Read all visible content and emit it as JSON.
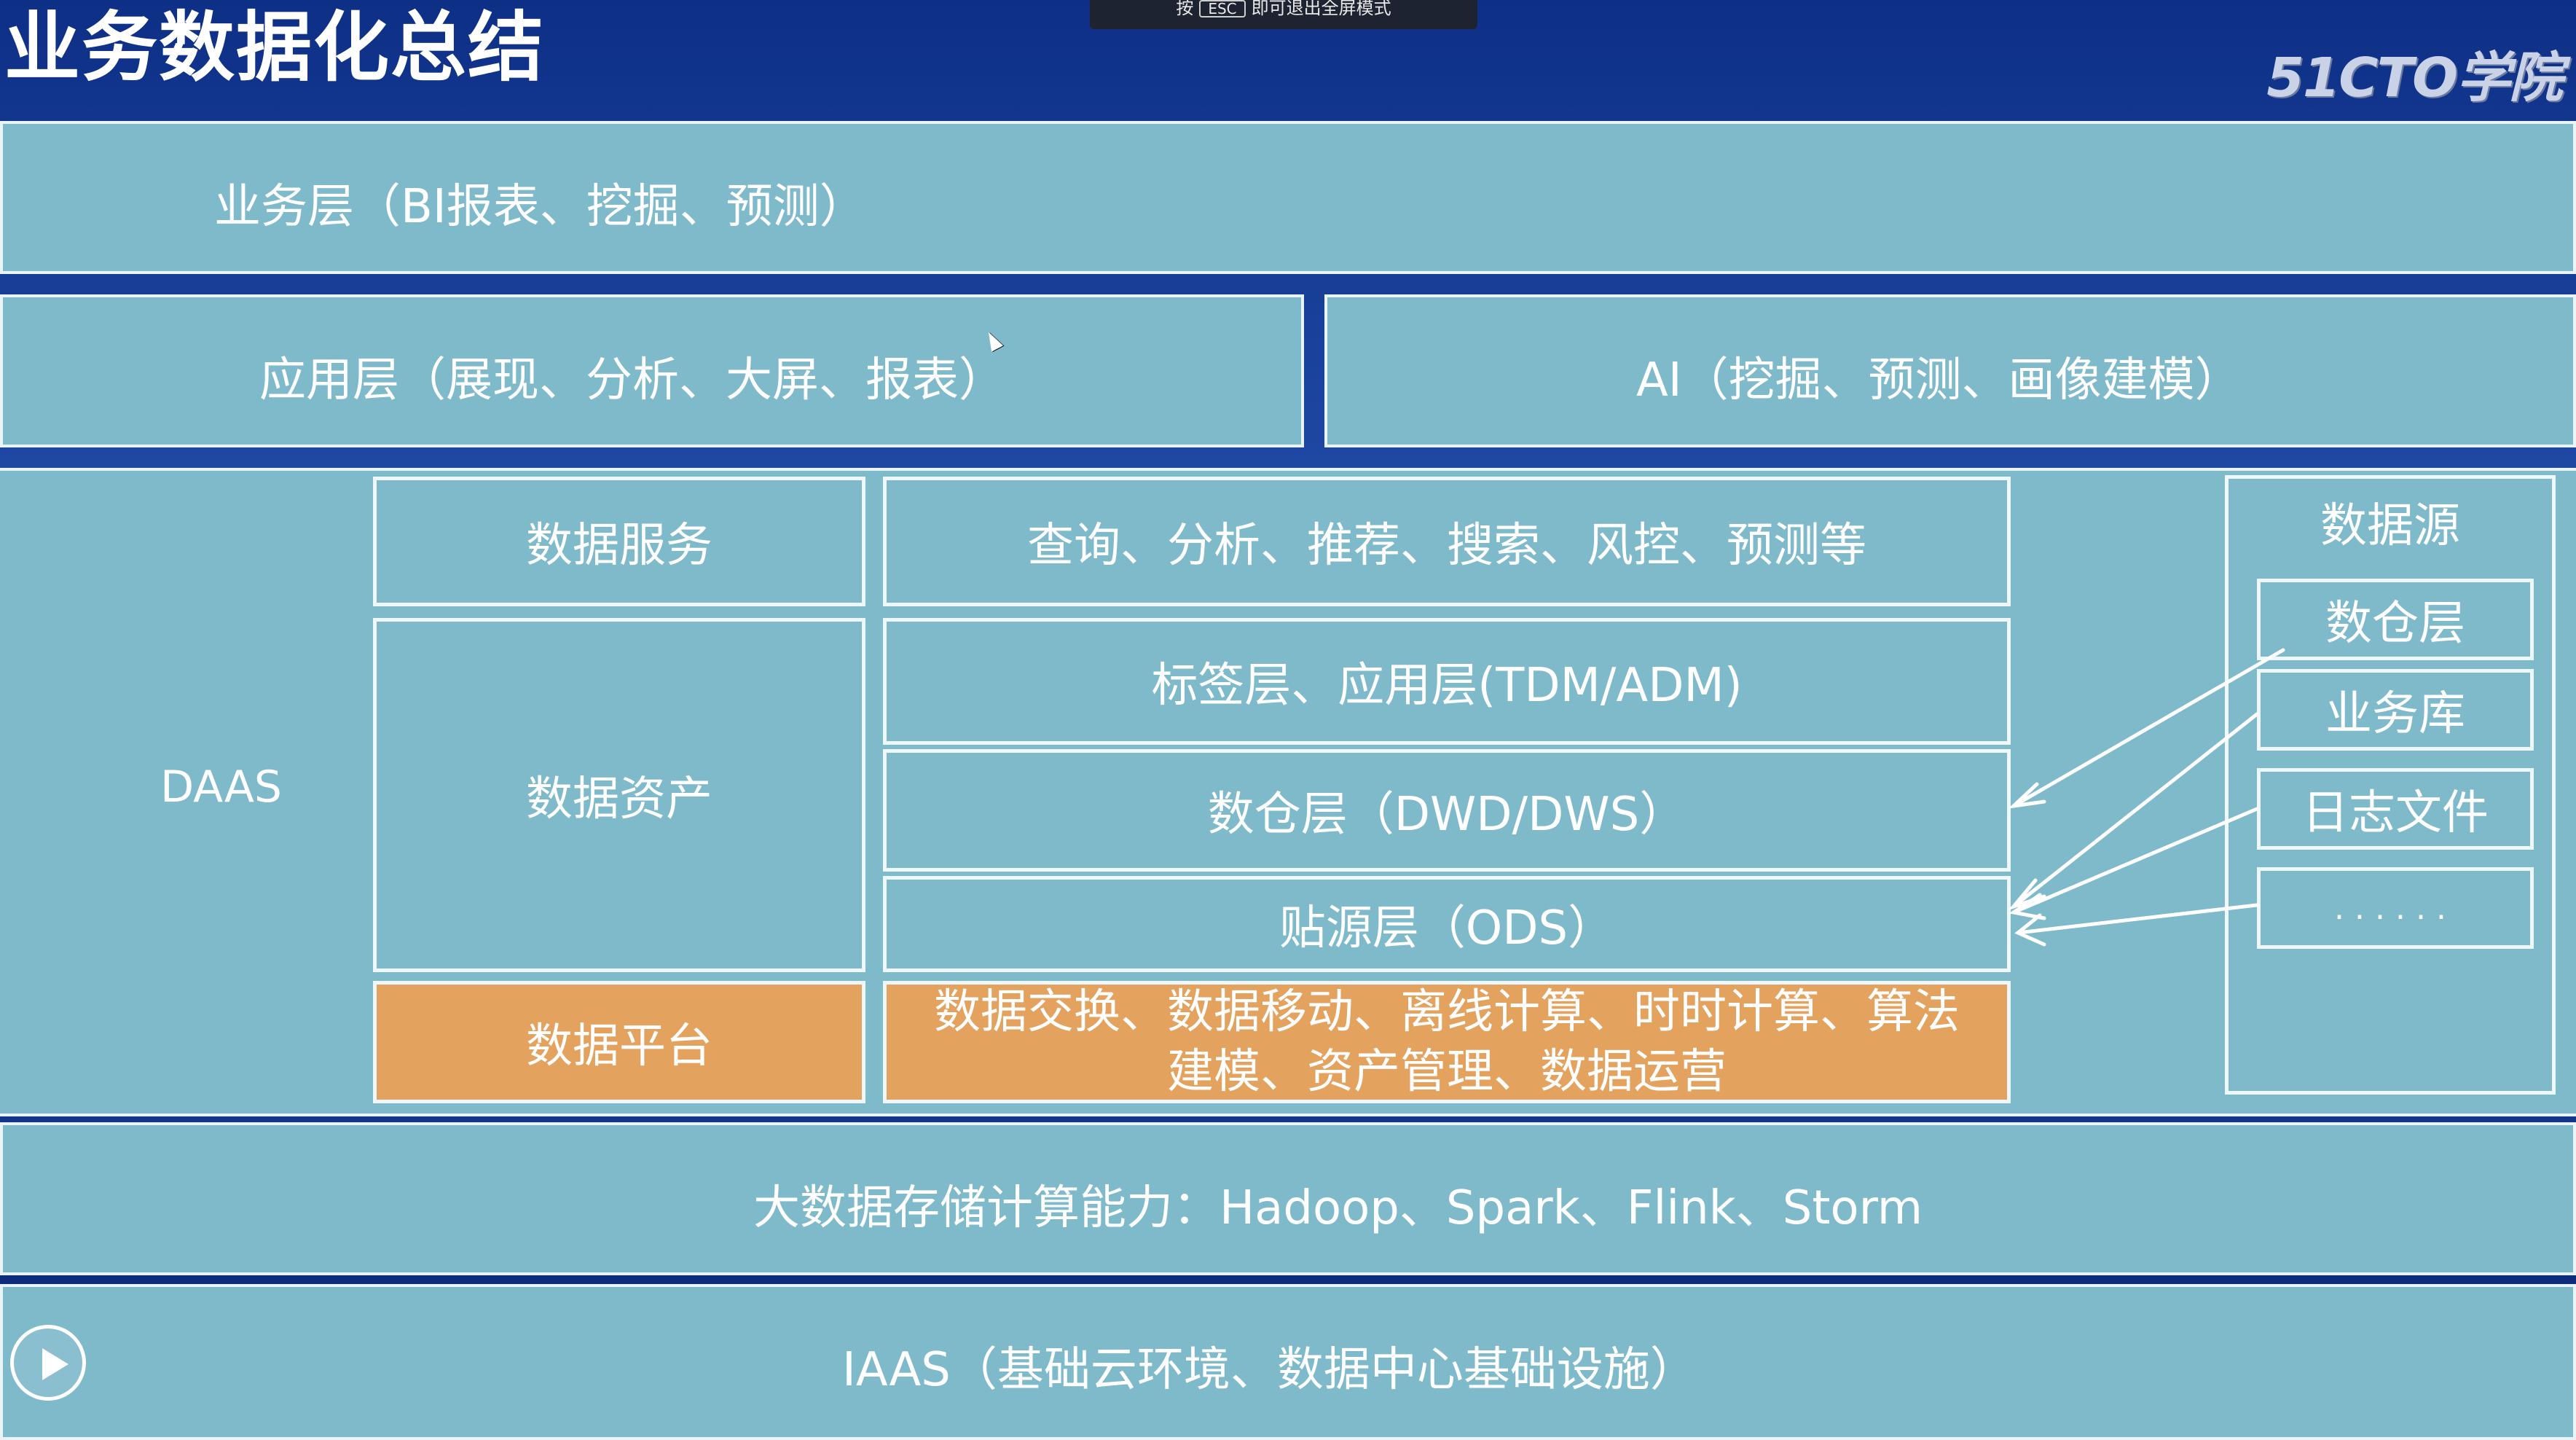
{
  "title": "业务数据化总结",
  "logo": "51CTO学院",
  "toast": {
    "before": "按",
    "key": "ESC",
    "after": "即可退出全屏模式"
  },
  "layers": {
    "business": "业务层（BI报表、挖掘、预测）",
    "application": "应用层（展现、分析、大屏、报表）",
    "ai": "AI（挖掘、预测、画像建模）",
    "daas": "DAAS",
    "storage": "大数据存储计算能力：Hadoop、Spark、Flink、Storm",
    "iaas": "IAAS（基础云环境、数据中心基础设施）"
  },
  "left_boxes": {
    "service": "数据服务",
    "asset": "数据资产",
    "platform": "数据平台"
  },
  "middle_boxes": {
    "service_desc": "查询、分析、推荐、搜索、风控、预测等",
    "tag_layer": "标签层、应用层(TDM/ADM)",
    "warehouse_layer": "数仓层（DWD/DWS）",
    "ods_layer": "贴源层（ODS）",
    "platform_desc_line1": "数据交换、数据移动、离线计算、时时计算、算法",
    "platform_desc_line2": "建模、资产管理、数据运营"
  },
  "data_sources": {
    "title": "数据源",
    "items": [
      "数仓层",
      "业务库",
      "日志文件",
      "......"
    ]
  },
  "colors": {
    "panel": "#7fbacb",
    "highlight": "#e4a25f",
    "header_bg": "#1f4aa5",
    "border": "#eef7fb"
  },
  "icons": [
    "play-icon",
    "cursor-icon",
    "arrow-icon"
  ]
}
